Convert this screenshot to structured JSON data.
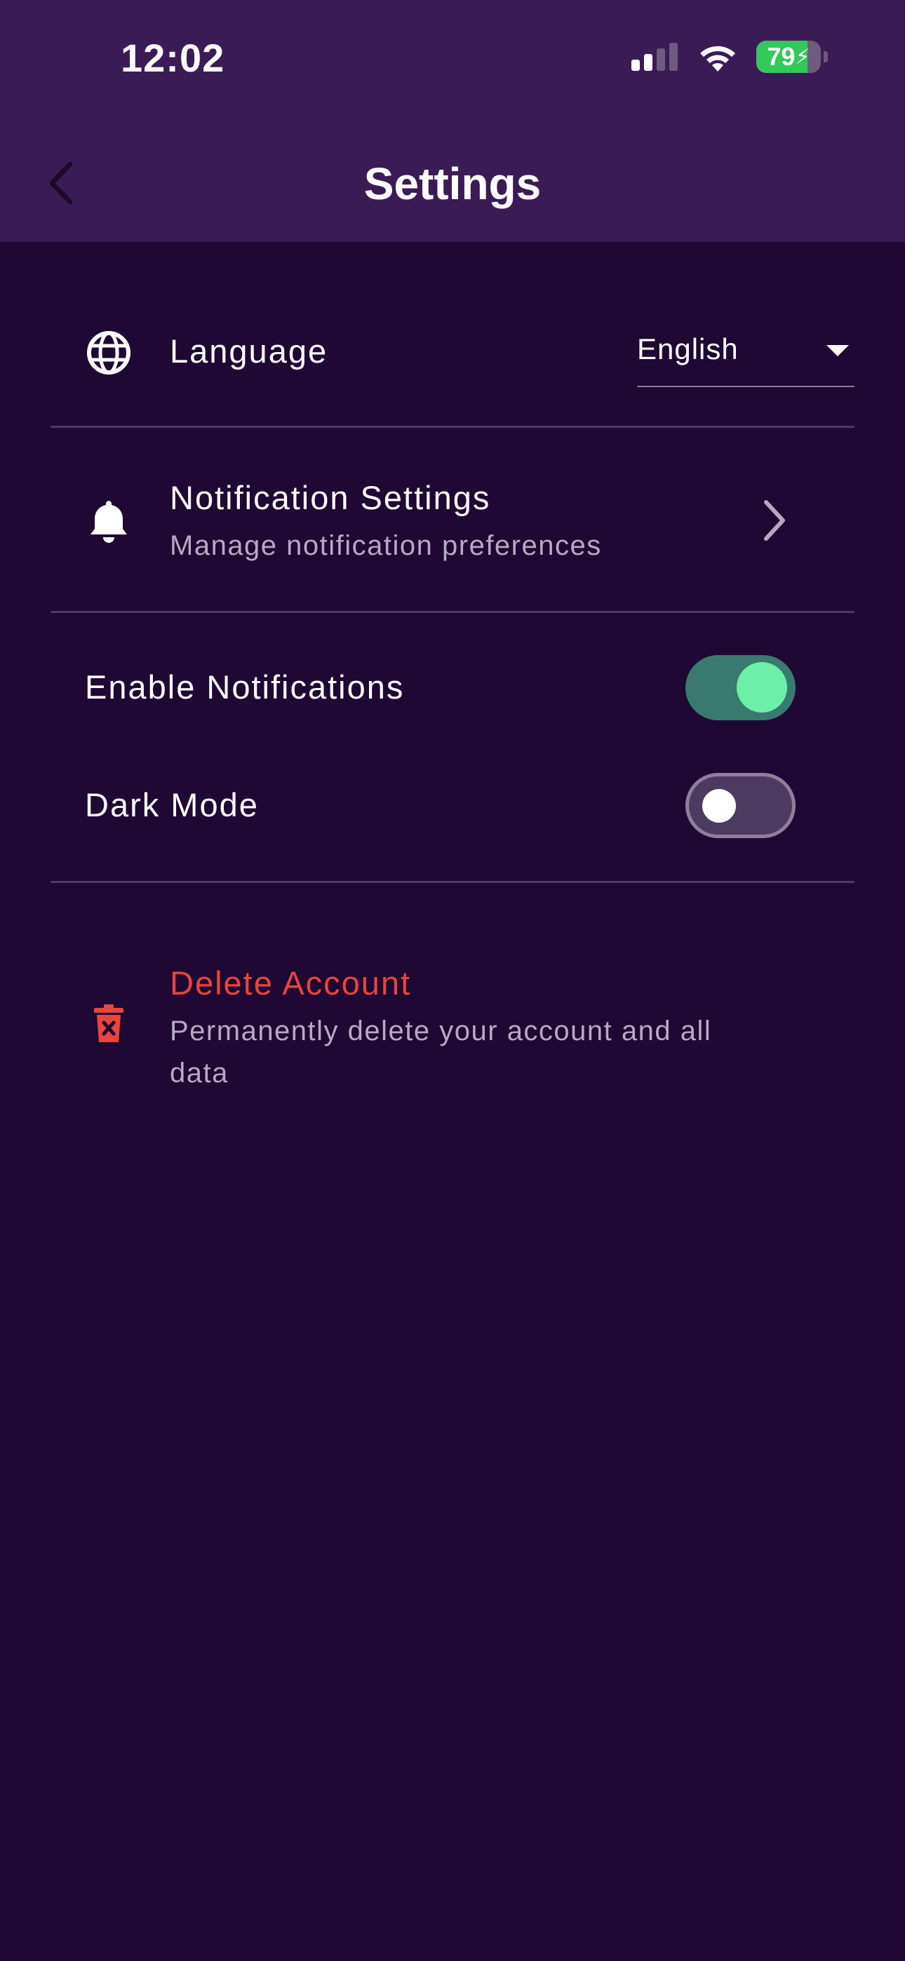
{
  "status_bar": {
    "time": "12:02",
    "battery_level": "79",
    "battery_fraction": 0.79
  },
  "header": {
    "title": "Settings",
    "back_icon": "chevron-left-icon"
  },
  "language": {
    "label": "Language",
    "icon": "globe-icon",
    "selected": "English"
  },
  "notification_settings": {
    "label": "Notification Settings",
    "subtitle": "Manage notification preferences",
    "icon": "bell-icon"
  },
  "enable_notifications": {
    "label": "Enable Notifications",
    "enabled": true
  },
  "dark_mode": {
    "label": "Dark Mode",
    "enabled": false
  },
  "delete_account": {
    "label": "Delete Account",
    "subtitle_line1": "Permanently delete your account and all",
    "subtitle_line2": "data",
    "icon": "trash-icon"
  },
  "colors": {
    "background": "#1f0833",
    "header": "#3b1b55",
    "danger": "#e8453c",
    "toggle_on_track": "#3a7a6e",
    "toggle_on_knob": "#6cf0a8",
    "battery": "#34c759"
  }
}
